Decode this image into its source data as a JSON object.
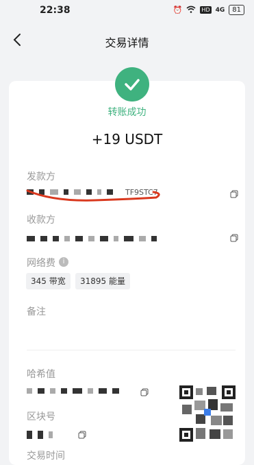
{
  "status_bar": {
    "time": "22:38",
    "network": "4G",
    "hd": "HD",
    "battery": "81"
  },
  "header": {
    "title": "交易详情"
  },
  "transaction": {
    "status": "转账成功",
    "amount": "+19 USDT",
    "sender_label": "发款方",
    "sender_visible_suffix": "TF9STC7",
    "receiver_label": "收款方",
    "fee_label": "网络费",
    "fee_items": [
      "345 带宽",
      "31895 能量"
    ],
    "memo_label": "备注",
    "hash_label": "哈希值",
    "block_label": "区块号",
    "time_label": "交易时间"
  },
  "colors": {
    "success": "#3fb27f",
    "annotation": "#d9381e"
  }
}
